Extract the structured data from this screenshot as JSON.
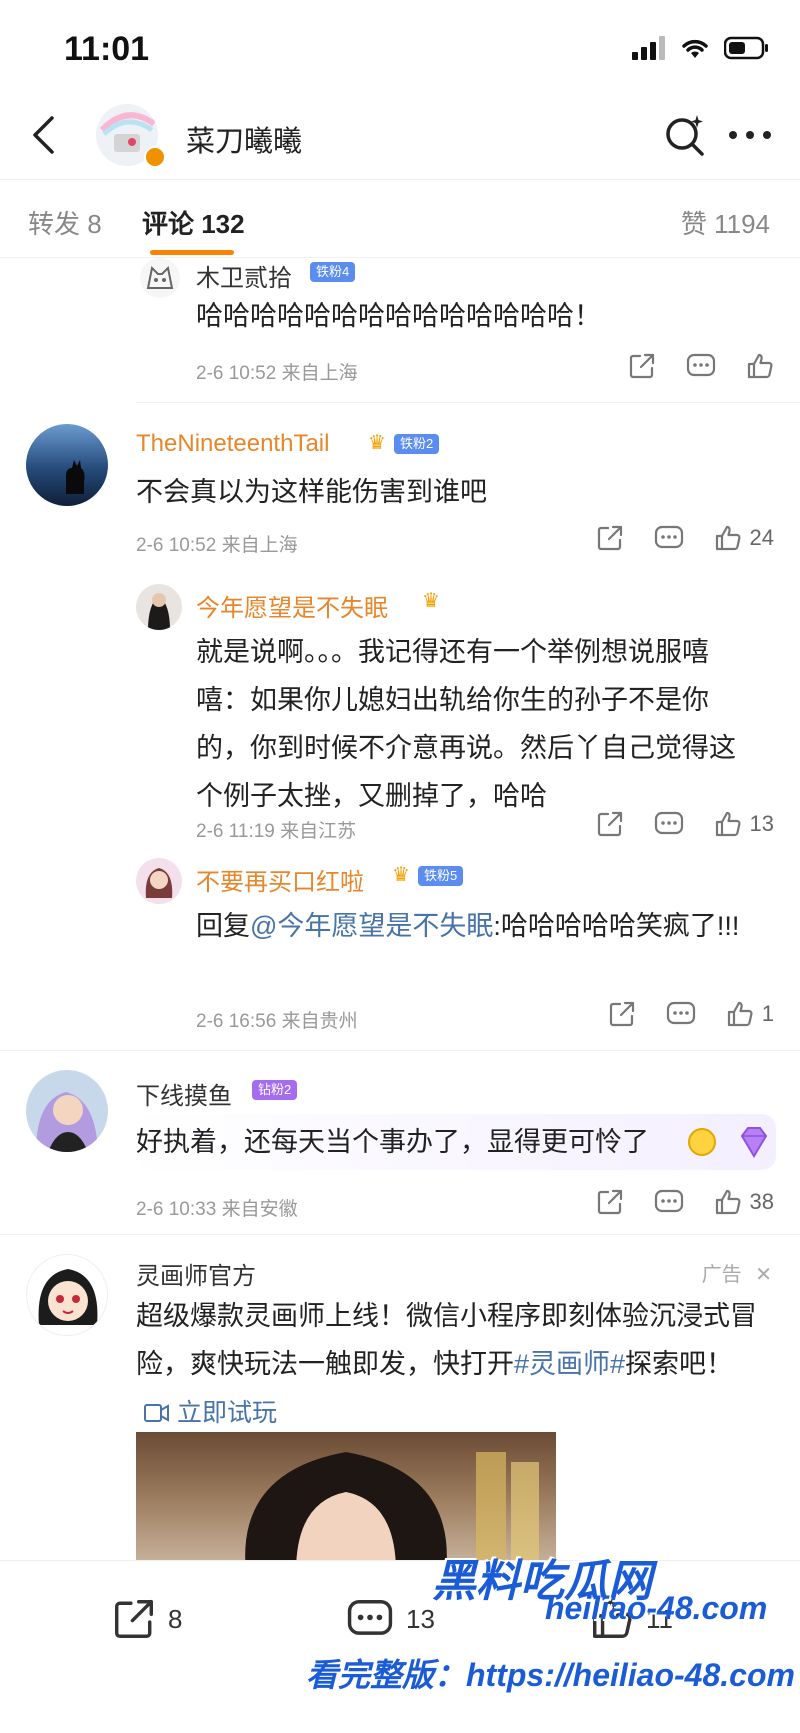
{
  "status": {
    "time": "11:01"
  },
  "header": {
    "title": "菜刀曦曦"
  },
  "tabs": {
    "repost": "转发 8",
    "comments": "评论 132",
    "likes": "赞 1194"
  },
  "comments": [
    {
      "name": "木卫贰拾",
      "badge": "铁粉4",
      "text": "哈哈哈哈哈哈哈哈哈哈哈哈哈哈！",
      "meta": "2-6 10:52 来自上海",
      "likes": ""
    },
    {
      "name": "TheNineteenthTail",
      "badge": "铁粉2",
      "text": "不会真以为这样能伤害到谁吧",
      "meta": "2-6 10:52 来自上海",
      "likes": "24"
    },
    {
      "name": "今年愿望是不失眠",
      "text": "就是说啊。。。我记得还有一个举例想说服嘻嘻：如果你儿媳妇出轨给你生的孙子不是你的，你到时候不介意再说。然后丫自己觉得这个例子太挫，又删掉了，哈哈",
      "meta": "2-6 11:19 来自江苏",
      "likes": "13"
    },
    {
      "name": "不要再买口红啦",
      "badge": "铁粉5",
      "reply_prefix": "回复",
      "mention": "@今年愿望是不失眠",
      "text": ":哈哈哈哈哈笑疯了!!!",
      "meta": "2-6 16:56 来自贵州",
      "likes": "1"
    },
    {
      "name": "下线摸鱼",
      "badge": "钻粉2",
      "text": "好执着，还每天当个事办了，显得更可怜了",
      "meta": "2-6 10:33 来自安徽",
      "likes": "38"
    }
  ],
  "ad": {
    "name": "灵画师官方",
    "label": "广告",
    "text_1": "超级爆款灵画师上线！微信小程序即刻体验沉浸式冒险，爽快玩法一触即发，快打开",
    "hashtag": "#灵画师#",
    "text_2": "探索吧！",
    "cta": "立即试玩"
  },
  "bottom_bar": {
    "repost_count": "8",
    "comment_count": "13",
    "like_count": "11"
  },
  "watermark": {
    "line1": "黑料吃瓜网",
    "line2": "heiliao-48.com",
    "line3": "看完整版：https://heiliao-48.com"
  },
  "colors": {
    "accent": "#ff8200",
    "link": "#4873a8",
    "name_orange": "#e8862a"
  }
}
